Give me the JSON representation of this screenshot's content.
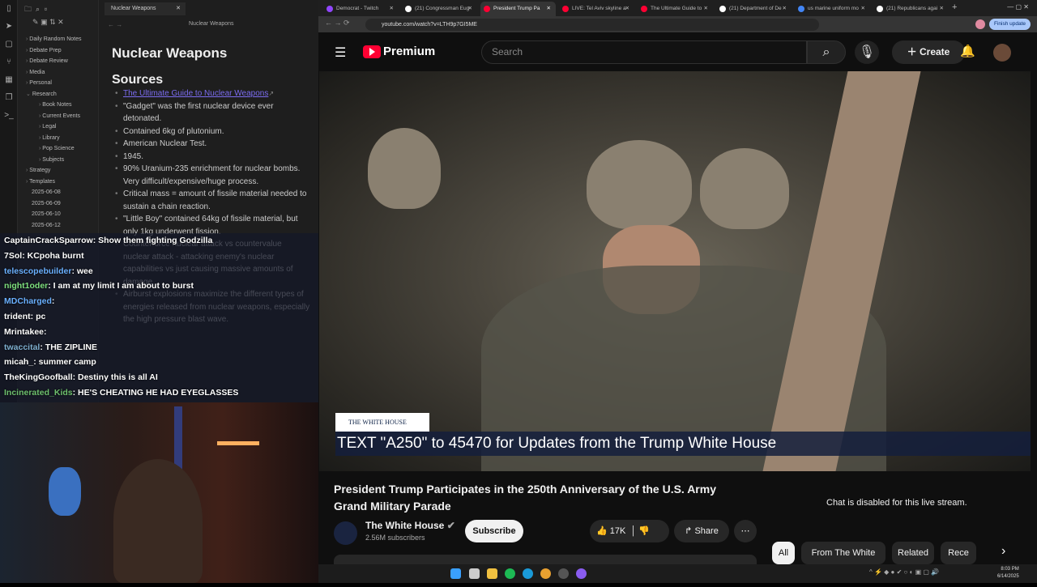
{
  "obsidian": {
    "tab_title": "Nuclear Weapons",
    "header_title": "Nuclear Weapons",
    "tree": [
      "Daily Random Notes",
      "Debate Prep",
      "Debate Review",
      "Media",
      "Personal",
      "Research",
      "Book Notes",
      "Current Events",
      "Legal",
      "Library",
      "Pop Science",
      "Subjects",
      "Strategy",
      "Templates",
      "2025-06-08",
      "2025-06-09",
      "2025-06-10",
      "2025-06-12"
    ],
    "note": {
      "title": "Nuclear Weapons",
      "heading": "Sources",
      "link": "The Ultimate Guide to Nuclear Weapons",
      "bullets": [
        "\"Gadget\" was the first nuclear device ever detonated.",
        "Contained 6kg of plutonium.",
        "American Nuclear Test.",
        "1945.",
        "90% Uranium-235 enrichment for nuclear bombs. Very difficult/expensive/huge process.",
        "Critical mass = amount of fissile material needed to sustain a chain reaction.",
        "\"Little Boy\" contained 64kg of fissile material, but only 1kg underwent fission.",
        "Counterforce nuclear attack vs countervalue nuclear attack - attacking enemy's nuclear capabilities vs just causing massive amounts of damage",
        "Airburst explosions maximize the different types of energies released from nuclear weapons, especially the high pressure blast wave."
      ]
    }
  },
  "chat": [
    {
      "user": "CaptainCrackSparrow",
      "color": "#ffffff",
      "msg": "Show them fighting Godzilla"
    },
    {
      "user": "7Sol",
      "color": "#ffffff",
      "msg": "KCpoha burnt"
    },
    {
      "user": "telescopebuilder",
      "color": "#6ab0ff",
      "msg": "wee"
    },
    {
      "user": "night1oder",
      "color": "#7ee07e",
      "msg": "I am at my limit  I am about to burst"
    },
    {
      "user": "MDCharged",
      "color": "#6ab0ff",
      "msg": ""
    },
    {
      "user": "trident",
      "color": "#ffffff",
      "msg": "pc"
    },
    {
      "user": "Mrintakee",
      "color": "#ffffff",
      "msg": ""
    },
    {
      "user": "twaccital",
      "color": "#7fb0d0",
      "msg": "THE ZIPLINE"
    },
    {
      "user": "micah_",
      "color": "#ffffff",
      "msg": "summer camp"
    },
    {
      "user": "TheKingGoofball",
      "color": "#ffffff",
      "msg": "Destiny this is all AI"
    },
    {
      "user": "Incinerated_Kids",
      "color": "#6ec06e",
      "msg": "HE'S CHEATING  HE HAD EYEGLASSES"
    }
  ],
  "browser": {
    "tabs": [
      {
        "label": "Democrat - Twitch",
        "color": "#9146ff"
      },
      {
        "label": "(21) Congressman Eug",
        "color": "#ffffff"
      },
      {
        "label": "President Trump Pa",
        "color": "#ff0033",
        "active": true
      },
      {
        "label": "LIVE: Tel Aviv skyline a",
        "color": "#ff0033"
      },
      {
        "label": "The Ultimate Guide to",
        "color": "#ff0033"
      },
      {
        "label": "(21) Department of De",
        "color": "#ffffff"
      },
      {
        "label": "us marine uniform mo",
        "color": "#4285f4"
      },
      {
        "label": "(21) Republicans agai",
        "color": "#ffffff"
      }
    ],
    "url": "youtube.com/watch?v=LTH9p7GI5ME",
    "finish_update": "Finish update"
  },
  "youtube": {
    "logo": "Premium",
    "search_placeholder": "Search",
    "create": "Create",
    "video": {
      "brand_tag": "THE WHITE HOUSE",
      "banner": "TEXT \"A250\" to 45470 for Updates from the Trump White House"
    },
    "title": "President Trump Participates in the 250th Anniversary of the U.S. Army Grand Military Parade",
    "channel": "The White House",
    "subscribers": "2.56M subscribers",
    "subscribe": "Subscribe",
    "likes": "17K",
    "share": "Share",
    "chat_disabled": "Chat is disabled for this live stream.",
    "chips": [
      "All",
      "From The White House",
      "Related",
      "Rece"
    ]
  },
  "taskbar": {
    "time": "8:03 PM",
    "date": "6/14/2025"
  }
}
